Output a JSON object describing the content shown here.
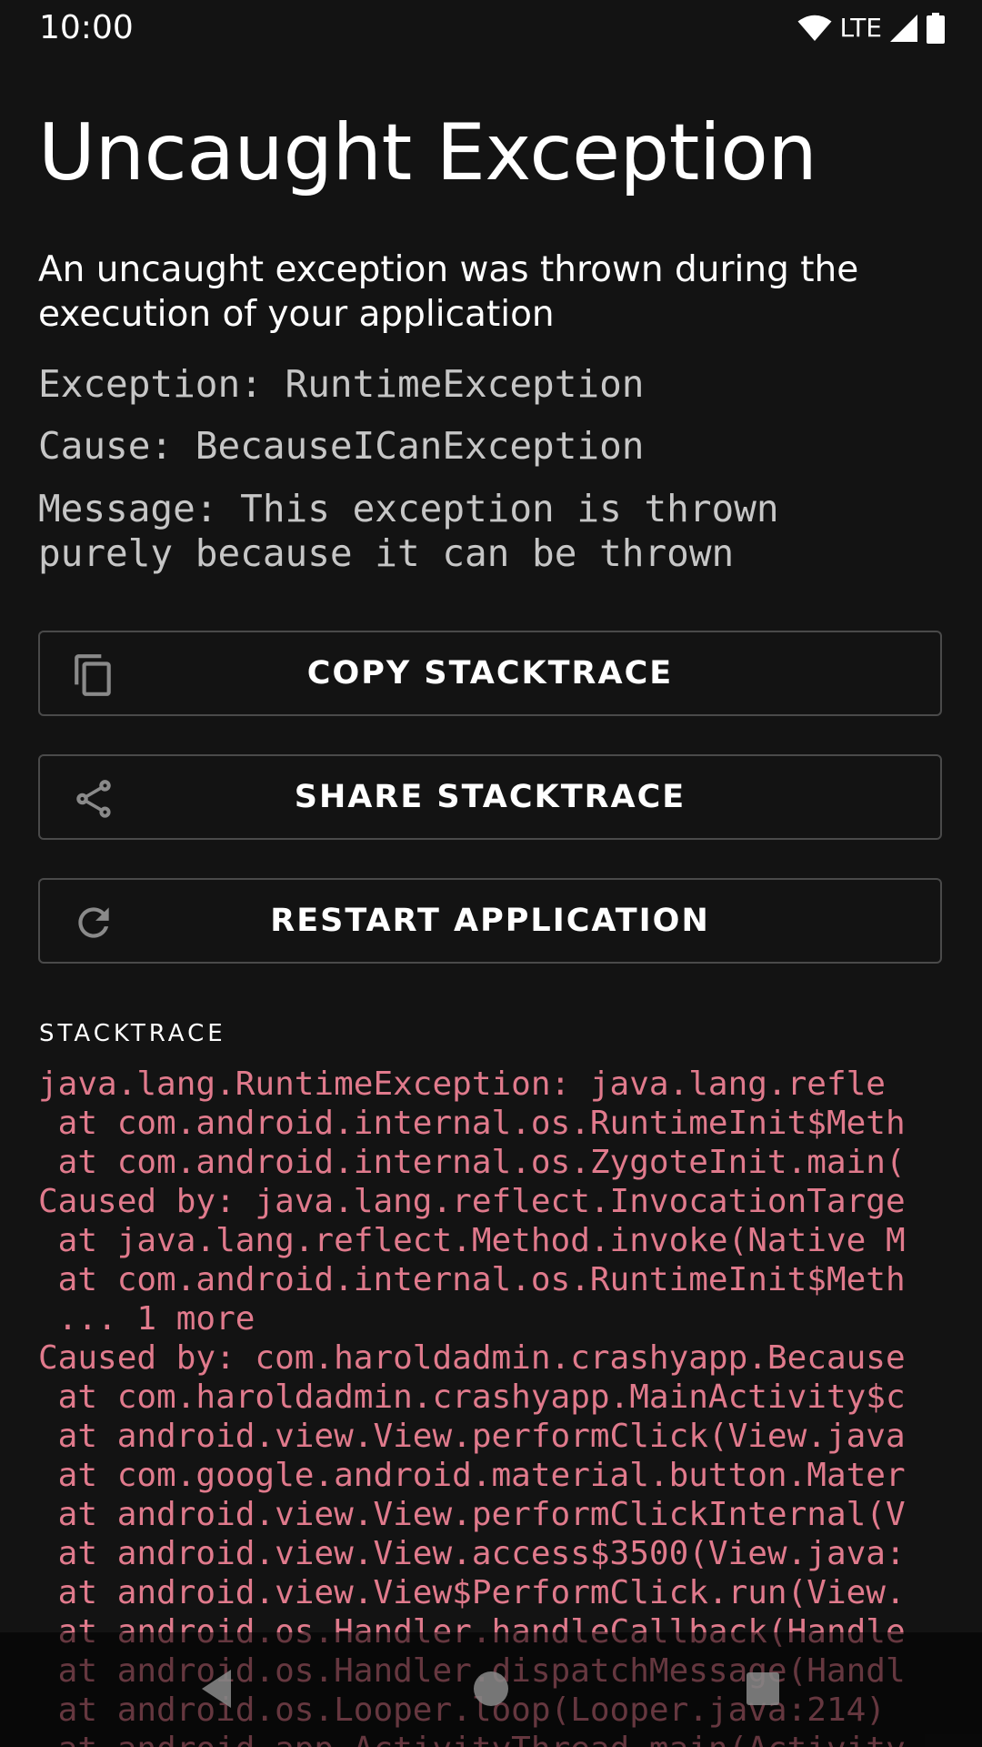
{
  "status_bar": {
    "time": "10:00",
    "network": "LTE",
    "icons": [
      "wifi-icon",
      "signal-icon",
      "battery-icon"
    ]
  },
  "title": "Uncaught Exception",
  "description": "An uncaught exception was thrown during the execution of your application",
  "details": {
    "exception": "Exception: RuntimeException",
    "cause": "Cause: BecauseICanException",
    "message_line1": "Message: This exception is thrown",
    "message_line2": "purely because it can be thrown"
  },
  "buttons": [
    {
      "label": "COPY STACKTRACE",
      "icon": "copy-icon"
    },
    {
      "label": "SHARE STACKTRACE",
      "icon": "share-icon"
    },
    {
      "label": "RESTART APPLICATION",
      "icon": "refresh-icon"
    }
  ],
  "stacktrace_label": "STACKTRACE",
  "stacktrace_lines": [
    "java.lang.RuntimeException: java.lang.refle",
    " at com.android.internal.os.RuntimeInit$Meth",
    " at com.android.internal.os.ZygoteInit.main(",
    "Caused by: java.lang.reflect.InvocationTarge",
    " at java.lang.reflect.Method.invoke(Native M",
    " at com.android.internal.os.RuntimeInit$Meth",
    " ... 1 more",
    "Caused by: com.haroldadmin.crashyapp.Because",
    " at com.haroldadmin.crashyapp.MainActivity$c",
    " at android.view.View.performClick(View.java",
    " at com.google.android.material.button.Mater",
    " at android.view.View.performClickInternal(V",
    " at android.view.View.access$3500(View.java:",
    " at android.view.View$PerformClick.run(View.",
    " at android.os.Handler.handleCallback(Handle",
    " at android.os.Handler.dispatchMessage(Handl",
    " at android.os.Looper.loop(Looper.java:214)",
    " at android.app.ActivityThread.main(Activity"
  ],
  "colors": {
    "background": "#131313",
    "stacktrace_text": "#e07a8c",
    "detail_text": "#c6c6c6",
    "button_border": "#4a4a4a"
  },
  "navigation": [
    "back-icon",
    "home-icon",
    "recents-icon"
  ]
}
